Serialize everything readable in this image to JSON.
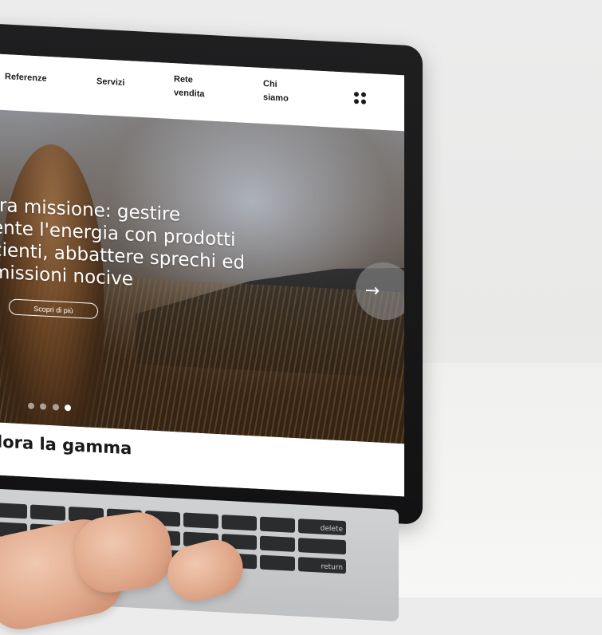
{
  "site": {
    "nav": {
      "items": [
        {
          "label": "Referenze"
        },
        {
          "label": "Servizi"
        },
        {
          "label": "Rete\nvendita"
        },
        {
          "label": "Chi\nsiamo"
        }
      ],
      "menu_icon": "grid-menu-icon"
    },
    "hero": {
      "title": "tra missione: gestire\nente l'energia con prodotti\ncienti, abbattere sprechi ed\nmissioni nocive",
      "cta_label": "Scopri di più",
      "next_arrow": "→",
      "slide_total": 4,
      "slide_active": 4
    },
    "section": {
      "title": "lora la gamma"
    }
  },
  "keyboard": {
    "labels": [
      "delete",
      "return"
    ]
  },
  "colors": {
    "nav_bg": "#ffffff",
    "nav_text": "#1a1a1a",
    "hero_text": "#ffffff",
    "arrow_bg": "#8f8f8f"
  }
}
